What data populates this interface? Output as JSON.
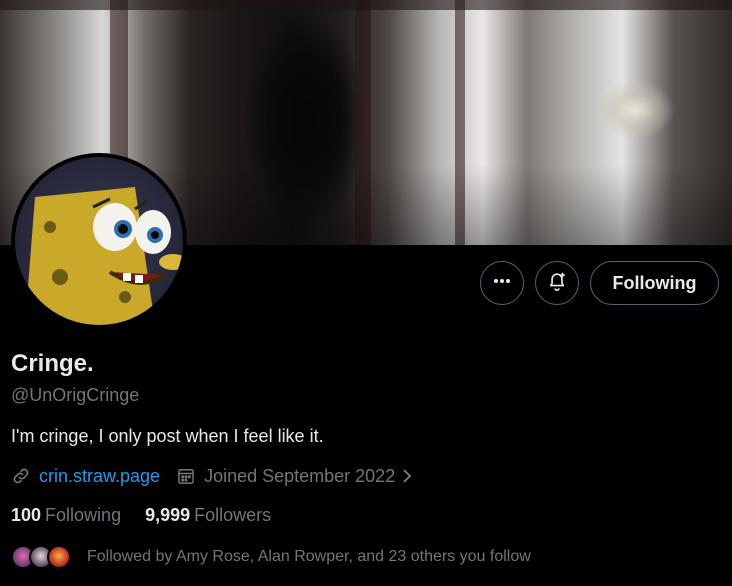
{
  "profile": {
    "display_name": "Cringe.",
    "handle": "@UnOrigCringe",
    "bio": "I'm cringe, I only post when I feel like it.",
    "website": "crin.straw.page",
    "joined": "Joined September 2022"
  },
  "actions": {
    "following_label": "Following"
  },
  "stats": {
    "following_count": "100",
    "following_label": "Following",
    "followers_count": "9,999",
    "followers_label": "Followers"
  },
  "followed_by": {
    "text": "Followed by Amy Rose, Alan Rowper, and 23 others you follow"
  },
  "icons": {
    "more": "more-icon",
    "notify": "bell-plus-icon",
    "link": "link-icon",
    "calendar": "calendar-icon",
    "chevron": "chevron-right-icon"
  },
  "colors": {
    "background": "#000000",
    "text_primary": "#e7e9ea",
    "text_secondary": "#71767b",
    "link": "#1d9bf0",
    "button_border": "#536471"
  }
}
